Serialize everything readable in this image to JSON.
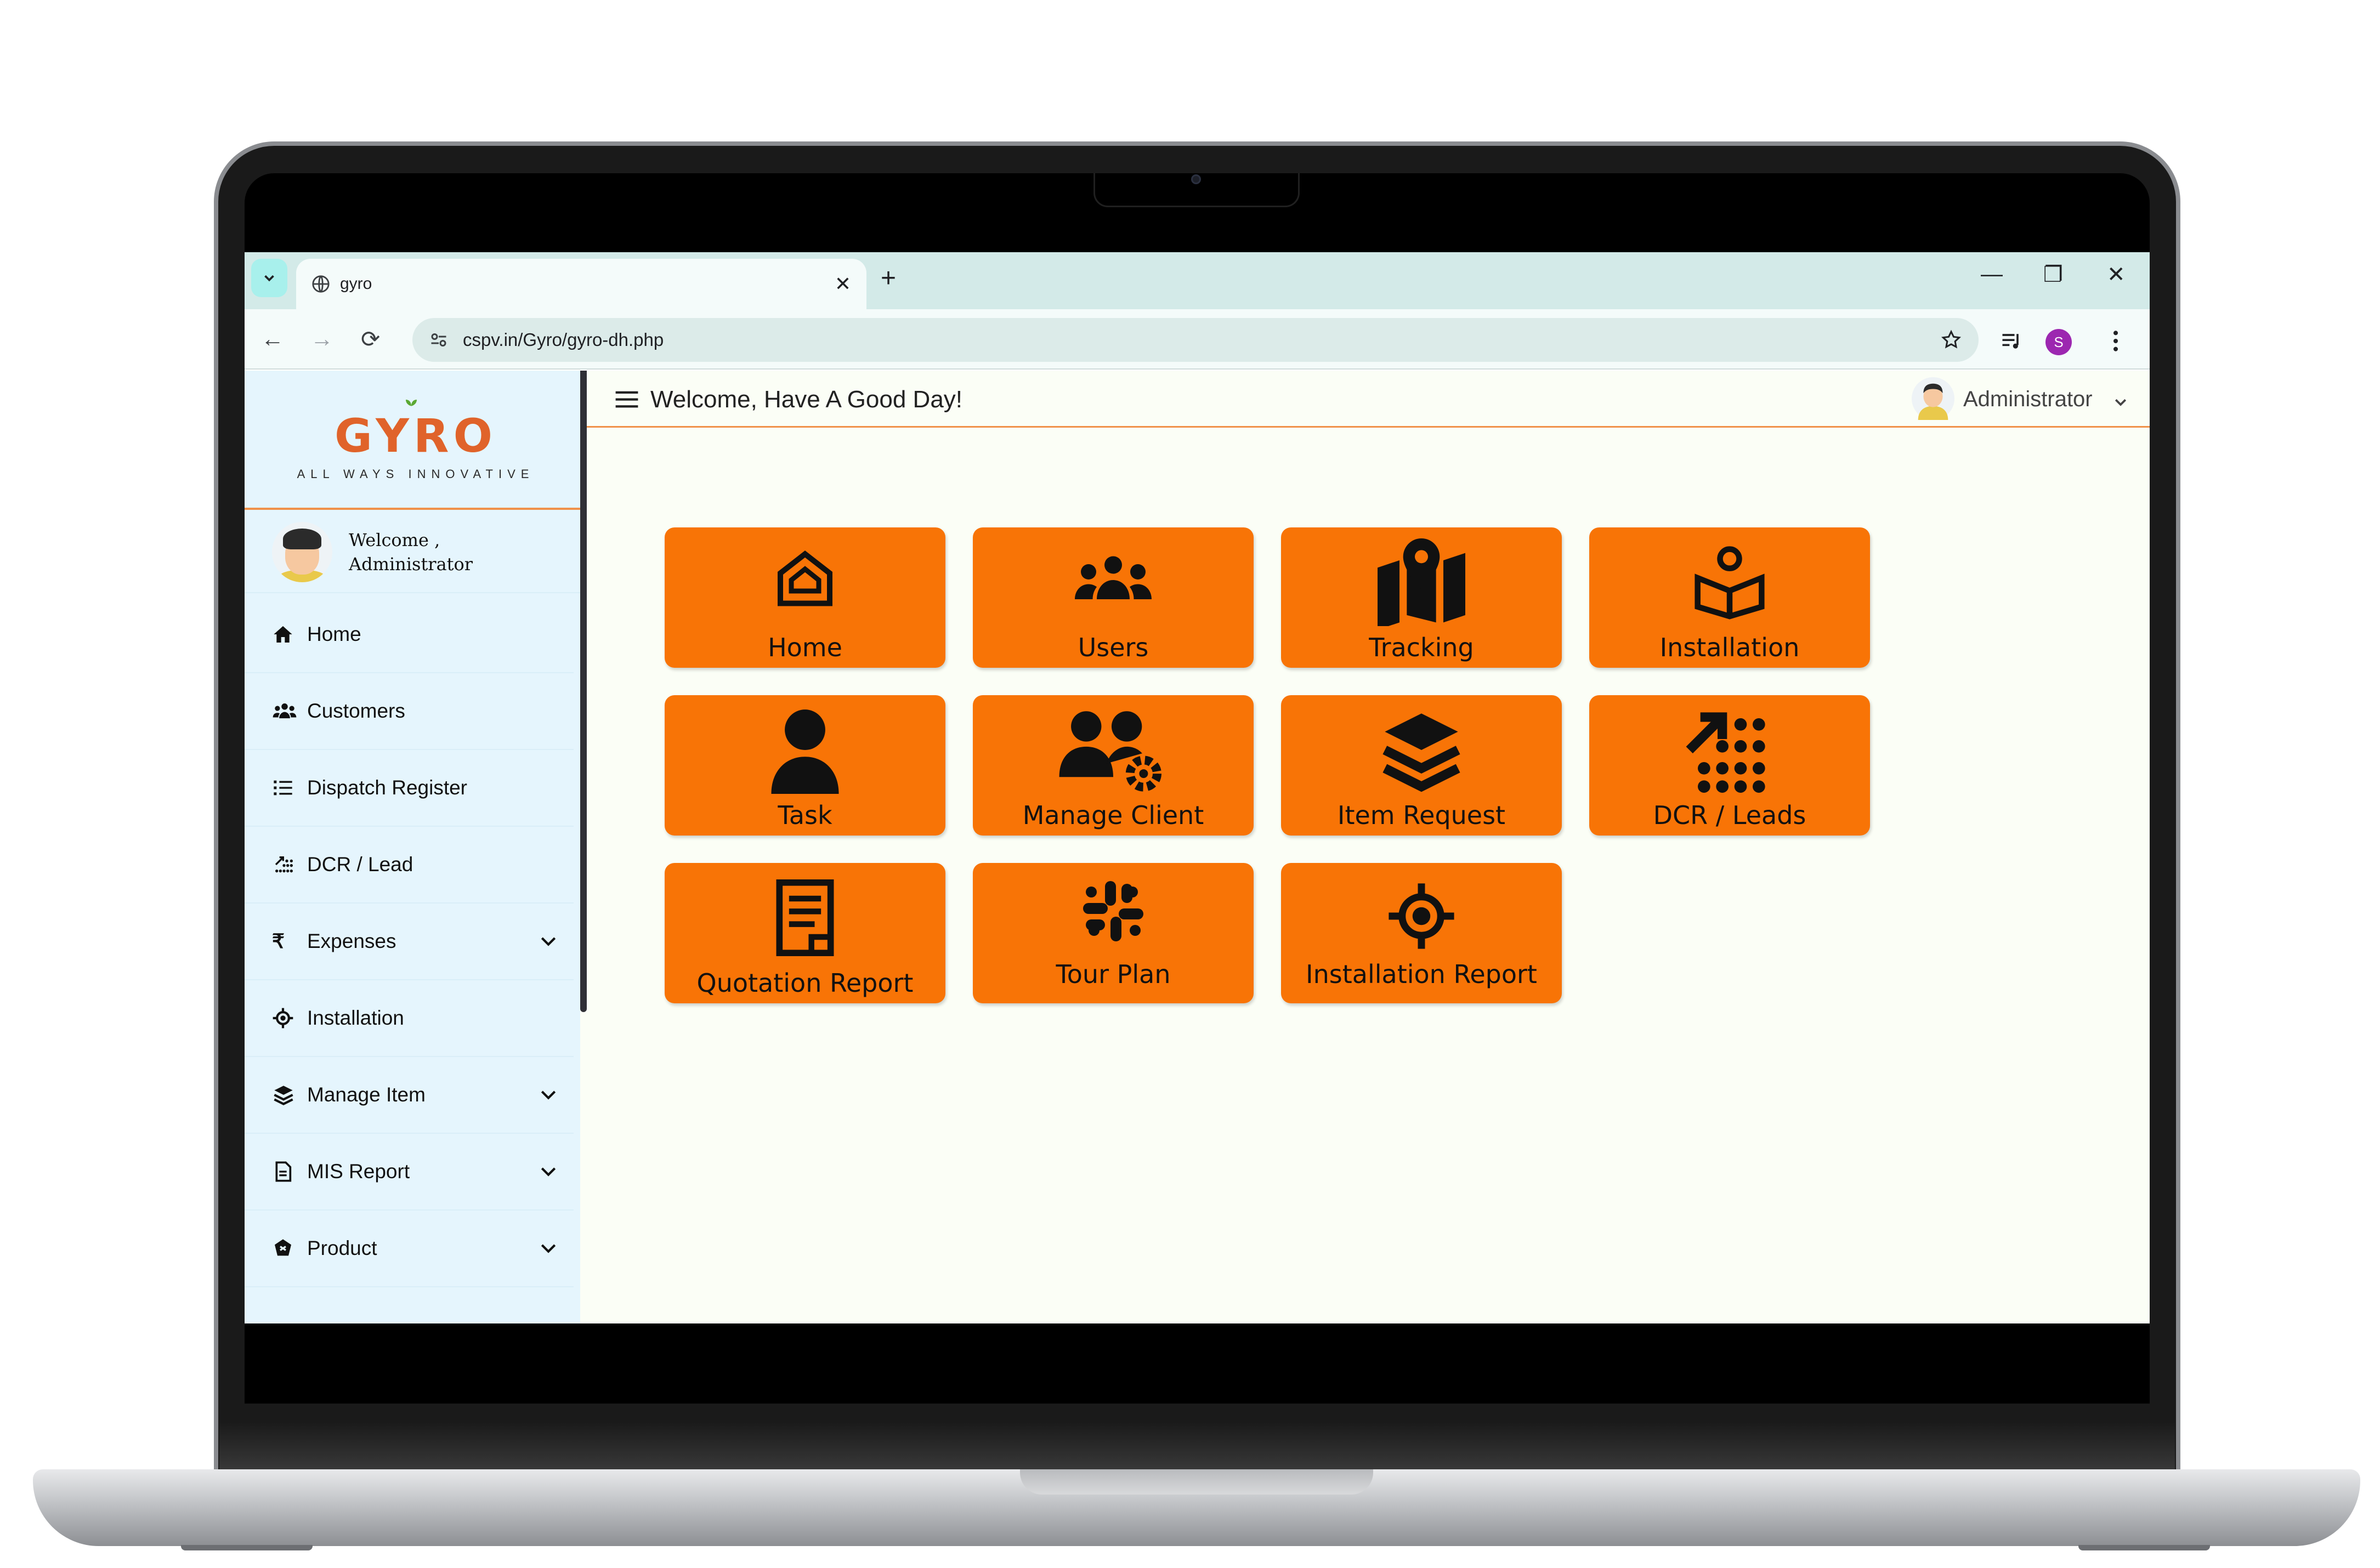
{
  "browser": {
    "tab_title": "gyro",
    "url": "cspv.in/Gyro/gyro-dh.php",
    "profile_initial": "S"
  },
  "brand": {
    "logo": "GYRO",
    "tagline": "ALL WAYS INNOVATIVE",
    "accent": "#f87406"
  },
  "sidebar": {
    "welcome_line1": "Welcome ,",
    "welcome_line2": "Administrator",
    "items": [
      {
        "label": "Home",
        "icon": "home-icon",
        "has_submenu": false
      },
      {
        "label": "Customers",
        "icon": "users-icon",
        "has_submenu": false
      },
      {
        "label": "Dispatch Register",
        "icon": "list-icon",
        "has_submenu": false
      },
      {
        "label": "DCR / Lead",
        "icon": "chart-dots-icon",
        "has_submenu": false
      },
      {
        "label": "Expenses",
        "icon": "rupee-icon",
        "has_submenu": true
      },
      {
        "label": "Installation",
        "icon": "target-icon",
        "has_submenu": false
      },
      {
        "label": "Manage Item",
        "icon": "layers-icon",
        "has_submenu": true
      },
      {
        "label": "MIS Report",
        "icon": "document-icon",
        "has_submenu": true
      },
      {
        "label": "Product",
        "icon": "product-icon",
        "has_submenu": true
      }
    ]
  },
  "header": {
    "title": "Welcome, Have A Good Day!",
    "user": "Administrator"
  },
  "tiles": [
    {
      "label": "Home",
      "icon": "home-icon"
    },
    {
      "label": "Users",
      "icon": "users-icon"
    },
    {
      "label": "Tracking",
      "icon": "map-icon"
    },
    {
      "label": "Installation",
      "icon": "installation-icon"
    },
    {
      "label": "Task",
      "icon": "person-icon"
    },
    {
      "label": "Manage Client",
      "icon": "users-gear-icon"
    },
    {
      "label": "Item Request",
      "icon": "layers-icon"
    },
    {
      "label": "DCR / Leads",
      "icon": "arrow-dots-icon"
    },
    {
      "label": "Quotation Report",
      "icon": "document-icon"
    },
    {
      "label": "Tour Plan",
      "icon": "slack-icon"
    },
    {
      "label": "Installation Report",
      "icon": "target-icon"
    }
  ]
}
